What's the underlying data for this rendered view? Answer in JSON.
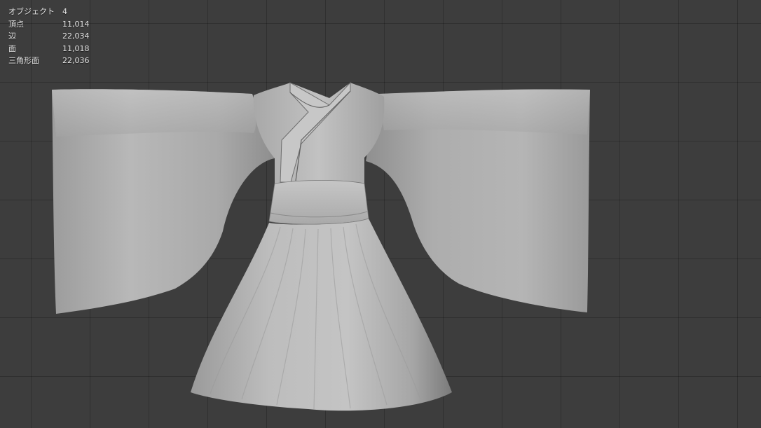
{
  "stats_overlay": {
    "rows": [
      {
        "label": "オブジェクト",
        "value": "4"
      },
      {
        "label": "頂点",
        "value": "11,014"
      },
      {
        "label": "辺",
        "value": "22,034"
      },
      {
        "label": "面",
        "value": "11,018"
      },
      {
        "label": "三角形面",
        "value": "22,036"
      }
    ]
  },
  "viewport": {
    "background_color": "#3d3d3d",
    "grid_line_color": "#2f2f2f",
    "model_color": "#b9b9b9",
    "model_subject": "hanfu-dress-mesh"
  }
}
